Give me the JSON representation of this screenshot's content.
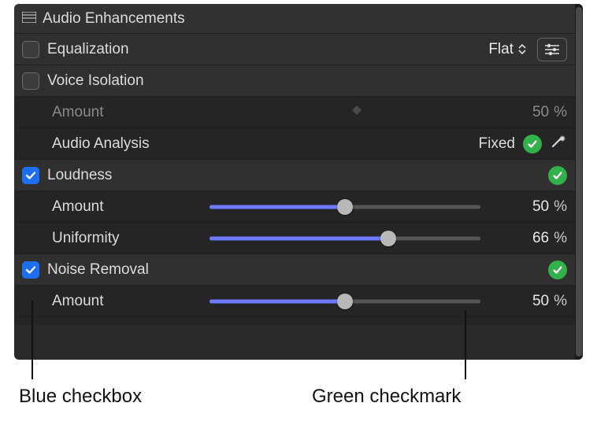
{
  "panel": {
    "title": "Audio Enhancements",
    "sections": {
      "equalization": {
        "label": "Equalization",
        "checked": false,
        "preset": "Flat"
      },
      "voice_isolation": {
        "label": "Voice Isolation",
        "checked": false,
        "amount": {
          "label": "Amount",
          "value": "50",
          "unit": "%"
        },
        "analysis": {
          "label": "Audio Analysis",
          "status": "Fixed"
        }
      },
      "loudness": {
        "label": "Loudness",
        "checked": true,
        "amount": {
          "label": "Amount",
          "value": "50",
          "unit": "%",
          "percent": 50
        },
        "uniformity": {
          "label": "Uniformity",
          "value": "66",
          "unit": "%",
          "percent": 66
        }
      },
      "noise_removal": {
        "label": "Noise Removal",
        "checked": true,
        "amount": {
          "label": "Amount",
          "value": "50",
          "unit": "%",
          "percent": 50
        }
      }
    }
  },
  "callouts": {
    "blue": "Blue checkbox",
    "green": "Green checkmark"
  }
}
